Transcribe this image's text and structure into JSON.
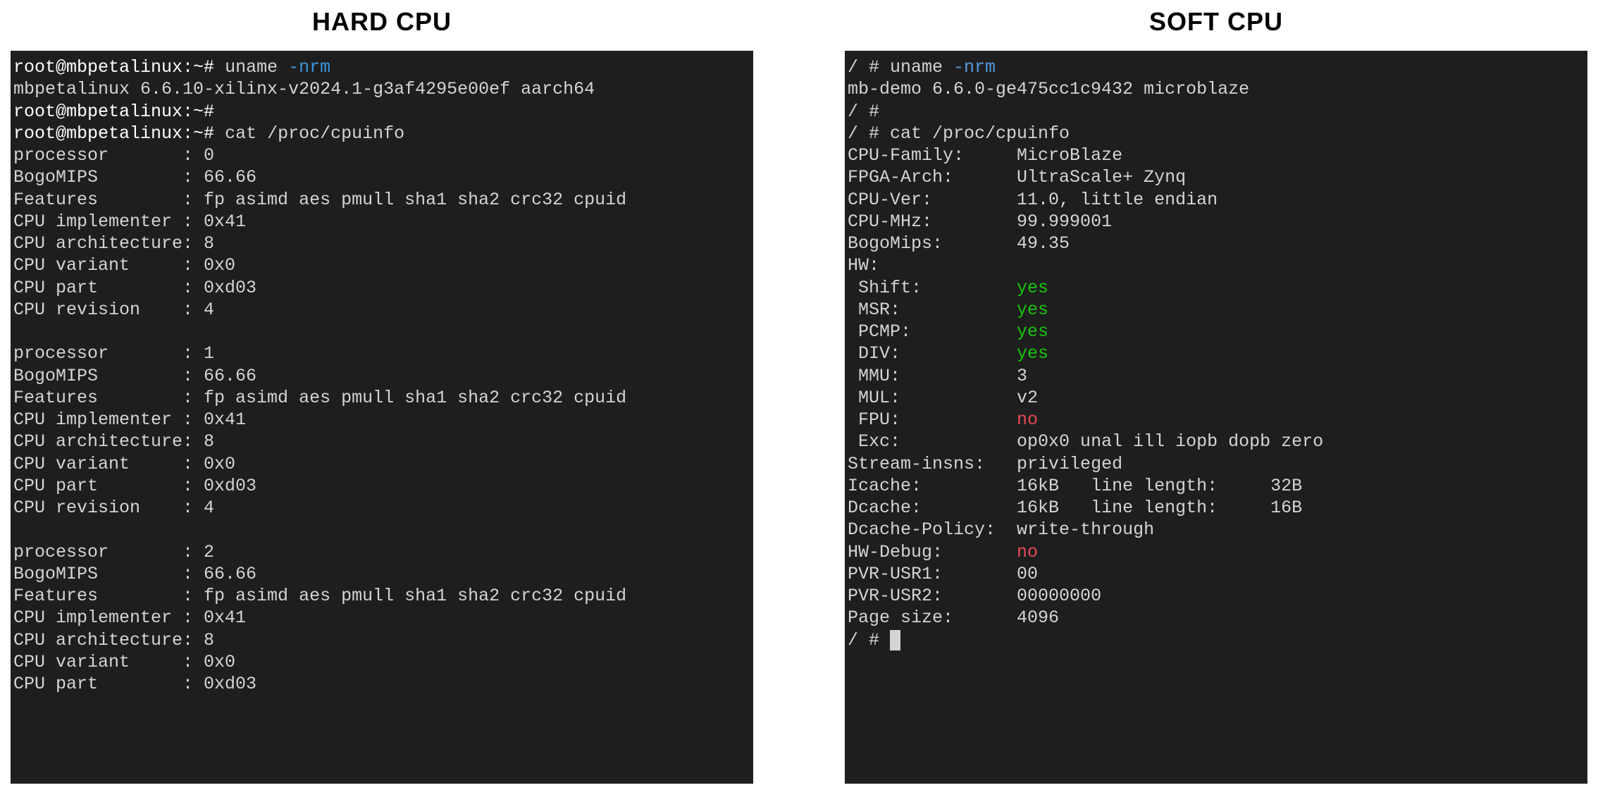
{
  "headings": {
    "hard": "HARD CPU",
    "soft": "SOFT CPU"
  },
  "hard": {
    "prompt": "root@mbpetalinux:~# ",
    "cmd_uname": "uname ",
    "flag_nrm": "-nrm",
    "uname_output": "mbpetalinux 6.6.10-xilinx-v2024.1-g3af4295e00ef aarch64",
    "cmd_cat": "cat /proc/cpuinfo",
    "processors": [
      {
        "id": "0",
        "lines": [
          "processor       : 0",
          "BogoMIPS        : 66.66",
          "Features        : fp asimd aes pmull sha1 sha2 crc32 cpuid",
          "CPU implementer : 0x41",
          "CPU architecture: 8",
          "CPU variant     : 0x0",
          "CPU part        : 0xd03",
          "CPU revision    : 4"
        ]
      },
      {
        "id": "1",
        "lines": [
          "processor       : 1",
          "BogoMIPS        : 66.66",
          "Features        : fp asimd aes pmull sha1 sha2 crc32 cpuid",
          "CPU implementer : 0x41",
          "CPU architecture: 8",
          "CPU variant     : 0x0",
          "CPU part        : 0xd03",
          "CPU revision    : 4"
        ]
      },
      {
        "id": "2",
        "lines_partial": [
          "processor       : 2",
          "BogoMIPS        : 66.66",
          "Features        : fp asimd aes pmull sha1 sha2 crc32 cpuid",
          "CPU implementer : 0x41",
          "CPU architecture: 8",
          "CPU variant     : 0x0",
          "CPU part        : 0xd03"
        ]
      }
    ]
  },
  "soft": {
    "prompt": "/ # ",
    "cmd_uname": "uname ",
    "flag_nrm": "-nrm",
    "uname_output": "mb-demo 6.6.0-ge475cc1c9432 microblaze",
    "cmd_cat": "cat /proc/cpuinfo",
    "rows": [
      {
        "label": "CPU-Family:     ",
        "value": "MicroBlaze"
      },
      {
        "label": "FPGA-Arch:      ",
        "value": "UltraScale+ Zynq"
      },
      {
        "label": "CPU-Ver:        ",
        "value": "11.0, little endian"
      },
      {
        "label": "CPU-MHz:        ",
        "value": "99.999001"
      },
      {
        "label": "BogoMips:       ",
        "value": "49.35"
      }
    ],
    "hw_label": "HW:",
    "hw_rows": [
      {
        "label": " Shift:         ",
        "value": "yes",
        "style": "green"
      },
      {
        "label": " MSR:           ",
        "value": "yes",
        "style": "green"
      },
      {
        "label": " PCMP:          ",
        "value": "yes",
        "style": "green"
      },
      {
        "label": " DIV:           ",
        "value": "yes",
        "style": "green"
      },
      {
        "label": " MMU:           ",
        "value": "3",
        "style": ""
      },
      {
        "label": " MUL:           ",
        "value": "v2",
        "style": ""
      },
      {
        "label": " FPU:           ",
        "value": "no",
        "style": "red"
      },
      {
        "label": " Exc:           ",
        "value": "op0x0 unal ill iopb dopb zero",
        "style": ""
      }
    ],
    "post_rows": [
      {
        "label": "Stream-insns:   ",
        "value": "privileged",
        "style": ""
      },
      {
        "label": "Icache:         ",
        "value": "16kB   line length:     32B",
        "style": ""
      },
      {
        "label": "Dcache:         ",
        "value": "16kB   line length:     16B",
        "style": ""
      },
      {
        "label": "Dcache-Policy:  ",
        "value": "write-through",
        "style": ""
      },
      {
        "label": "HW-Debug:       ",
        "value": "no",
        "style": "red"
      },
      {
        "label": "PVR-USR1:       ",
        "value": "00",
        "style": ""
      },
      {
        "label": "PVR-USR2:       ",
        "value": "00000000",
        "style": ""
      },
      {
        "label": "Page size:      ",
        "value": "4096",
        "style": ""
      }
    ],
    "cursor": " "
  }
}
